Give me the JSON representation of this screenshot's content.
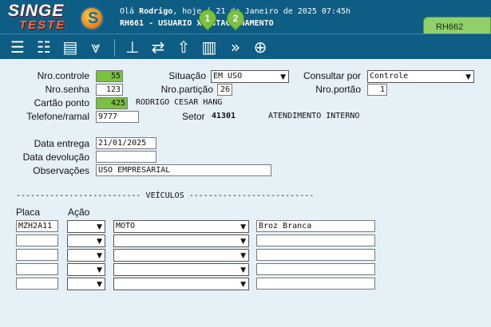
{
  "brand": {
    "line1": "SINGE",
    "line2": "TESTE",
    "badge_letter": "S"
  },
  "header": {
    "greeting_prefix": "Olá ",
    "user": "Rodrigo",
    "greeting_rest": ", hoje é 21 de Janeiro de 2025 07:45h",
    "screen": "RH661 - USUARIO X ESTACIONAMENTO"
  },
  "tag_label": "RH662",
  "pins": [
    "1",
    "2"
  ],
  "toolbar": {
    "icons": [
      "list-icon",
      "checklist-icon",
      "card-icon",
      "chevrons-down-icon",
      "stamp-icon",
      "refresh-icon",
      "upload-icon",
      "book-icon",
      "chevrons-right-icon",
      "zoom-icon"
    ]
  },
  "form": {
    "nro_controle_label": "Nro.controle",
    "nro_controle": "55",
    "situacao_label": "Situação",
    "situacao": "EM USO",
    "consultar_label": "Consultar por",
    "consultar": "Controle",
    "nro_senha_label": "Nro.senha",
    "nro_senha": "123",
    "nro_particao_label": "Nro.partição",
    "nro_particao": "26",
    "nro_portao_label": "Nro.portão",
    "nro_portao": "1",
    "cartao_label": "Cartão ponto",
    "cartao": "425",
    "cartao_nome": "RODRIGO CESAR HANG",
    "telefone_label": "Telefone/ramal",
    "telefone": "9777",
    "setor_label": "Setor",
    "setor_codigo": "41301",
    "setor_nome": "ATENDIMENTO INTERNO",
    "data_entrega_label": "Data entrega",
    "data_entrega": "21/01/2025",
    "data_devolucao_label": "Data devolução",
    "data_devolucao": "",
    "observacoes_label": "Observações",
    "observacoes": "USO EMPRESARIAL"
  },
  "vehicles": {
    "section_title": "-------------------------- VEÍCULOS --------------------------",
    "col_placa": "Placa",
    "col_acao": "Ação",
    "rows": [
      {
        "placa": "MZH2A11",
        "acao": "",
        "tipo": "MOTO",
        "descricao": "Broz Branca"
      },
      {
        "placa": "",
        "acao": "",
        "tipo": "",
        "descricao": ""
      },
      {
        "placa": "",
        "acao": "",
        "tipo": "",
        "descricao": ""
      },
      {
        "placa": "",
        "acao": "",
        "tipo": "",
        "descricao": ""
      },
      {
        "placa": "",
        "acao": "",
        "tipo": "",
        "descricao": ""
      }
    ]
  }
}
